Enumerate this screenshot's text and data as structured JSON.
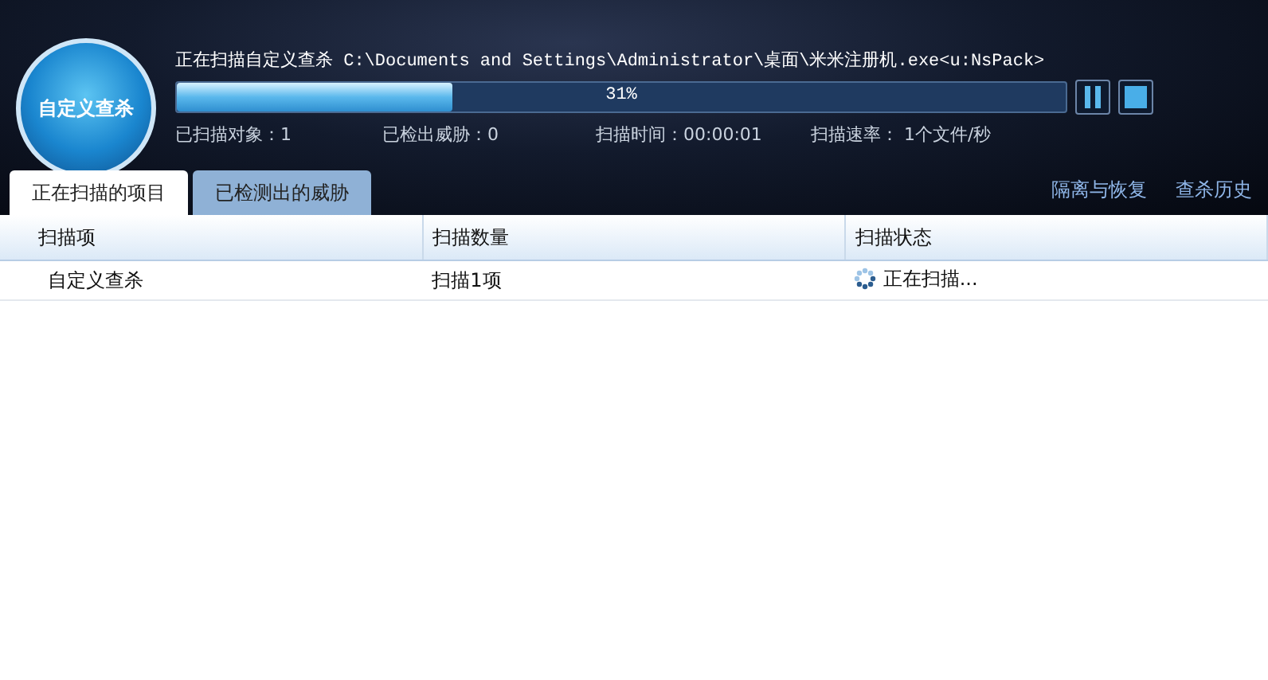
{
  "scan_badge": {
    "label": "自定义查杀"
  },
  "scan": {
    "current_file": "正在扫描自定义查杀 C:\\Documents and Settings\\Administrator\\桌面\\米米注册机.exe<u:NsPack>",
    "level": 0.31,
    "percent": "31%"
  },
  "stats": [
    {
      "label": "已扫描对象：1"
    },
    {
      "label": "已检出威胁：0"
    },
    {
      "label": "扫描时间：00:00:01"
    },
    {
      "label": "扫描速率： 1个文件/秒"
    }
  ],
  "tabs": [
    {
      "label": "正在扫描的项目",
      "selected": true
    },
    {
      "label": "已检测出的威胁",
      "selected": false
    }
  ],
  "links": [
    "隔离与恢复",
    "查杀历史"
  ],
  "table": {
    "columns": [
      "扫描项",
      "扫描数量",
      "扫描状态"
    ],
    "rows": [
      [
        "自定义查杀",
        "扫描1项",
        "正在扫描..."
      ]
    ]
  }
}
